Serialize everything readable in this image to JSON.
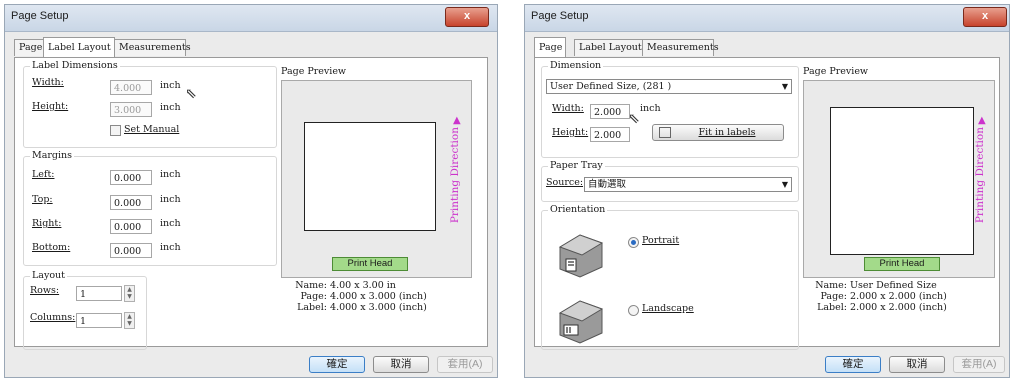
{
  "left_dialog": {
    "title": "Page Setup",
    "close": "x",
    "tabs": [
      "Page",
      "Label Layout",
      "Measurements"
    ],
    "label_dimensions": {
      "legend": "Label Dimensions",
      "width_label": "Width:",
      "width_value": "4.000",
      "height_label": "Height:",
      "height_value": "3.000",
      "unit": "inch",
      "set_manual": "Set Manual"
    },
    "margins": {
      "legend": "Margins",
      "left_label": "Left:",
      "left_value": "0.000",
      "top_label": "Top:",
      "top_value": "0.000",
      "right_label": "Right:",
      "right_value": "0.000",
      "bottom_label": "Bottom:",
      "bottom_value": "0.000",
      "unit": "inch"
    },
    "layout": {
      "legend": "Layout",
      "rows_label": "Rows:",
      "rows_value": "1",
      "columns_label": "Columns:",
      "columns_value": "1"
    },
    "preview": {
      "legend": "Page Preview",
      "print_head": "Print Head",
      "direction": "Printing Direction",
      "name_key": "Name:",
      "name_val": "4.00 x 3.00 in",
      "page_key": "Page:",
      "page_val": "4.000 x 3.000 (inch)",
      "label_key": "Label:",
      "label_val": "4.000 x 3.000 (inch)"
    },
    "buttons": {
      "ok": "確定",
      "cancel": "取消",
      "apply": "套用(A)"
    }
  },
  "right_dialog": {
    "title": "Page Setup",
    "close": "x",
    "tabs": [
      "Page",
      "Label Layout",
      "Measurements"
    ],
    "dimension": {
      "legend": "Dimension",
      "selected": "User Defined Size, (281 )",
      "width_label": "Width:",
      "width_value": "2.000",
      "height_label": "Height:",
      "height_value": "2.000",
      "unit": "inch",
      "fit_button": "Fit in labels"
    },
    "paper_tray": {
      "legend": "Paper Tray",
      "source_label": "Source:",
      "source_value": "自動選取"
    },
    "orientation": {
      "legend": "Orientation",
      "portrait": "Portrait",
      "landscape": "Landscape",
      "selected": "Portrait"
    },
    "preview": {
      "legend": "Page Preview",
      "print_head": "Print Head",
      "direction": "Printing Direction",
      "name_key": "Name:",
      "name_val": "User Defined Size",
      "page_key": "Page:",
      "page_val": "2.000 x 2.000 (inch)",
      "label_key": "Label:",
      "label_val": "2.000 x 2.000 (inch)"
    },
    "buttons": {
      "ok": "確定",
      "cancel": "取消",
      "apply": "套用(A)"
    }
  }
}
